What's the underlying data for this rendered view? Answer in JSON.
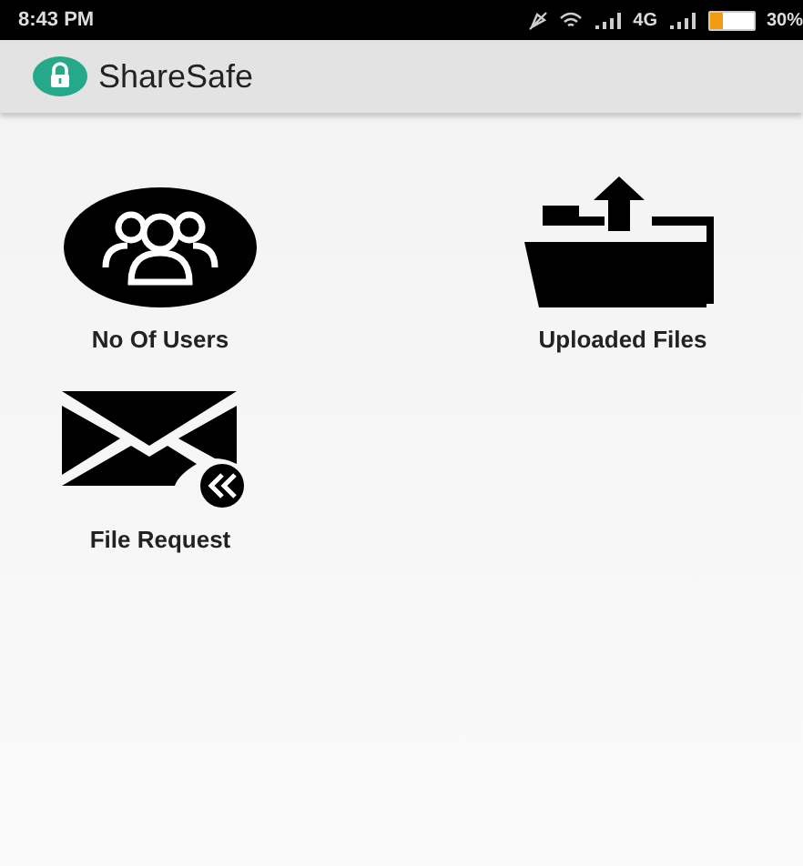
{
  "status_bar": {
    "time": "8:43 PM",
    "network": "4G",
    "battery": {
      "text": "30%",
      "level": 0.3
    }
  },
  "app_bar": {
    "title": "ShareSafe"
  },
  "tiles": [
    {
      "kind": "users",
      "label": "No Of Users"
    },
    {
      "kind": "folder",
      "label": "Uploaded Files"
    },
    {
      "kind": "mail",
      "label": "File Request"
    }
  ]
}
